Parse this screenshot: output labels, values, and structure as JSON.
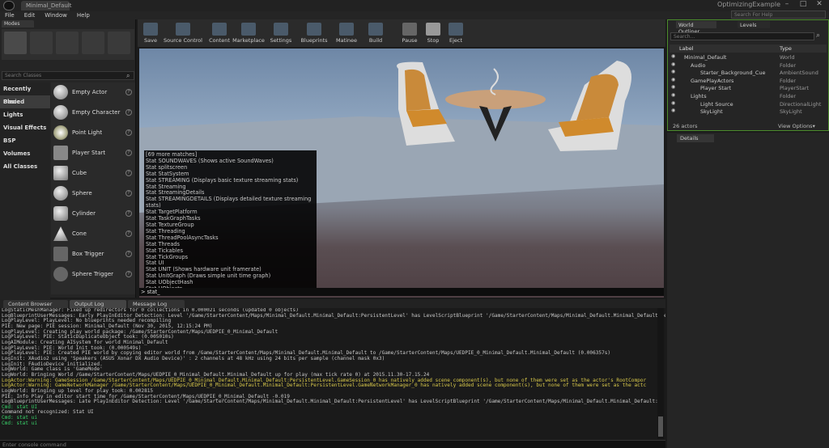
{
  "window": {
    "tab": "Minimal_Default",
    "title": "OptimizingExample",
    "min": "–",
    "max": "□",
    "close": "✕"
  },
  "menu": [
    "File",
    "Edit",
    "Window",
    "Help"
  ],
  "help_search": "Search For Help",
  "modes": {
    "tab": "Modes",
    "search_placeholder": "Search Classes",
    "categories": [
      "Recently Placed",
      "Basic",
      "Lights",
      "Visual Effects",
      "BSP",
      "Volumes",
      "All Classes"
    ],
    "items": [
      "Empty Actor",
      "Empty Character",
      "Point Light",
      "Player Start",
      "Cube",
      "Sphere",
      "Cylinder",
      "Cone",
      "Box Trigger",
      "Sphere Trigger"
    ]
  },
  "toolbar": [
    "Save",
    "Source Control",
    "Content",
    "Marketplace",
    "Settings",
    "Blueprints",
    "Matinee",
    "Build",
    "Pause",
    "Stop",
    "Eject"
  ],
  "autocomplete": [
    "[69 more matches]",
    "Stat SOUNDWAVES (Shows active SoundWaves)",
    "Stat splitscreen",
    "Stat StatSystem",
    "Stat STREAMING (Displays basic texture streaming stats)",
    "Stat Streaming",
    "Stat StreamingDetails",
    "Stat STREAMINGDETAILS (Displays detailed texture streaming stats)",
    "Stat TargetPlatform",
    "Stat TaskGraphTasks",
    "Stat TextureGroup",
    "Stat Threading",
    "Stat ThreadPoolAsyncTasks",
    "Stat Threads",
    "Stat Tickables",
    "Stat TickGroups",
    "Stat UI",
    "Stat UNIT (Shows hardware unit framerate)",
    "Stat UnitGraph (Draws simple unit time graph)",
    "Stat UObjectHash",
    "Stat UObjects"
  ],
  "console_input": "> stat_",
  "outliner": {
    "tab1": "World Outliner",
    "tab2": "Levels",
    "search_placeholder": "Search...",
    "col_label": "Label",
    "col_type": "Type",
    "rows": [
      {
        "label": "Minimal_Default",
        "type": "World"
      },
      {
        "label": "Audio",
        "type": "Folder"
      },
      {
        "label": "Starter_Background_Cue",
        "type": "AmbientSound"
      },
      {
        "label": "GamePlayActors",
        "type": "Folder"
      },
      {
        "label": "Player Start",
        "type": "PlayerStart"
      },
      {
        "label": "Lights",
        "type": "Folder"
      },
      {
        "label": "Light Source",
        "type": "DirectionalLight"
      },
      {
        "label": "SkyLight",
        "type": "SkyLight"
      }
    ],
    "actors": "26 actors",
    "view_options": "View Options▾"
  },
  "details_tab": "Details",
  "bottom_tabs": [
    "Content Browser",
    "Output Log",
    "Message Log"
  ],
  "log": [
    {
      "t": "LogStaticMeshManager: Fixed up redirectors for 0 collections in 0.000021 seconds (updated 0 objects)",
      "k": ""
    },
    {
      "t": "LogBlueprintUserMessages: Early PlayInEditor Detection: Level '/Game/StarterContent/Maps/Minimal_Default.Minimal_Default:PersistentLevel' has LevelScriptBlueprint '/Game/StarterContent/Maps/Minimal_Default.Minimal_Default:Pe",
      "k": ""
    },
    {
      "t": "LogPlayLevel: PlayLevel: No blueprints needed recompiling",
      "k": ""
    },
    {
      "t": "PIE: New page: PIE session: Minimal_Default (Nov 30, 2015, 12:15:24 PM)",
      "k": ""
    },
    {
      "t": "LogPlayLevel: Creating play world package: /Game/StarterContent/Maps/UEDPIE_0_Minimal_Default",
      "k": ""
    },
    {
      "t": "LogPlayLevel: PIE: StaticDuplicateObject took: (0.005010s)",
      "k": ""
    },
    {
      "t": "LogAIModule: Creating AISystem for world Minimal_Default",
      "k": ""
    },
    {
      "t": "LogPlayLevel: PIE: World Init took: (0.000549s)",
      "k": ""
    },
    {
      "t": "LogPlayLevel: PIE: Created PIE world by copying editor world from /Game/StarterContent/Maps/Minimal_Default.Minimal_Default to /Game/StarterContent/Maps/UEDPIE_0_Minimal_Default.Minimal_Default (0.006357s)",
      "k": ""
    },
    {
      "t": "LogInit: XAudio2 using 'Speakers (ASUS Xonar DX Audio Device)' : 2 channels at 48 kHz using 24 bits per sample (channel mask 0x3)",
      "k": ""
    },
    {
      "t": "LogInit: FAudioDevice initialized.",
      "k": ""
    },
    {
      "t": "LogWorld: Game class is 'GameMode'",
      "k": ""
    },
    {
      "t": "LogWorld: Bringing World /Game/StarterContent/Maps/UEDPIE_0_Minimal_Default.Minimal_Default up for play (max tick rate 0) at 2015.11.30-17.15.24",
      "k": ""
    },
    {
      "t": "LogActor:Warning: GameSession /Game/StarterContent/Maps/UEDPIE_0_Minimal_Default.Minimal_Default:PersistentLevel.GameSession_0 has natively added scene component(s), but none of them were set as the actor's RootCompor",
      "k": "warn"
    },
    {
      "t": "LogActor:Warning: GameNetworkManager /Game/StarterContent/Maps/UEDPIE_0_Minimal_Default.Minimal_Default:PersistentLevel.GameNetworkManager_0 has natively added scene component(s), but none of them were set as the actc",
      "k": "warn"
    },
    {
      "t": "LogWorld: Bringing up level for play took: 0.002815",
      "k": ""
    },
    {
      "t": "PIE: Info Play in editor start time for /Game/StarterContent/Maps/UEDPIE_0_Minimal_Default -0.019",
      "k": ""
    },
    {
      "t": "LogBlueprintUserMessages: Late PlayInEditor Detection: Level '/Game/StarterContent/Maps/Minimal_Default.Minimal_Default:PersistentLevel' has LevelScriptBlueprint '/Game/StarterContent/Maps/Minimal_Default.Minimal_Default:Pe",
      "k": ""
    },
    {
      "t": "Cmd: stat UI",
      "k": "cmd"
    },
    {
      "t": "Command not recognized: Stat UI",
      "k": ""
    },
    {
      "t": "Cmd: stat ui",
      "k": "cmd"
    },
    {
      "t": "Cmd: stat ui",
      "k": "cmd"
    }
  ],
  "console_placeholder": "Enter console command"
}
